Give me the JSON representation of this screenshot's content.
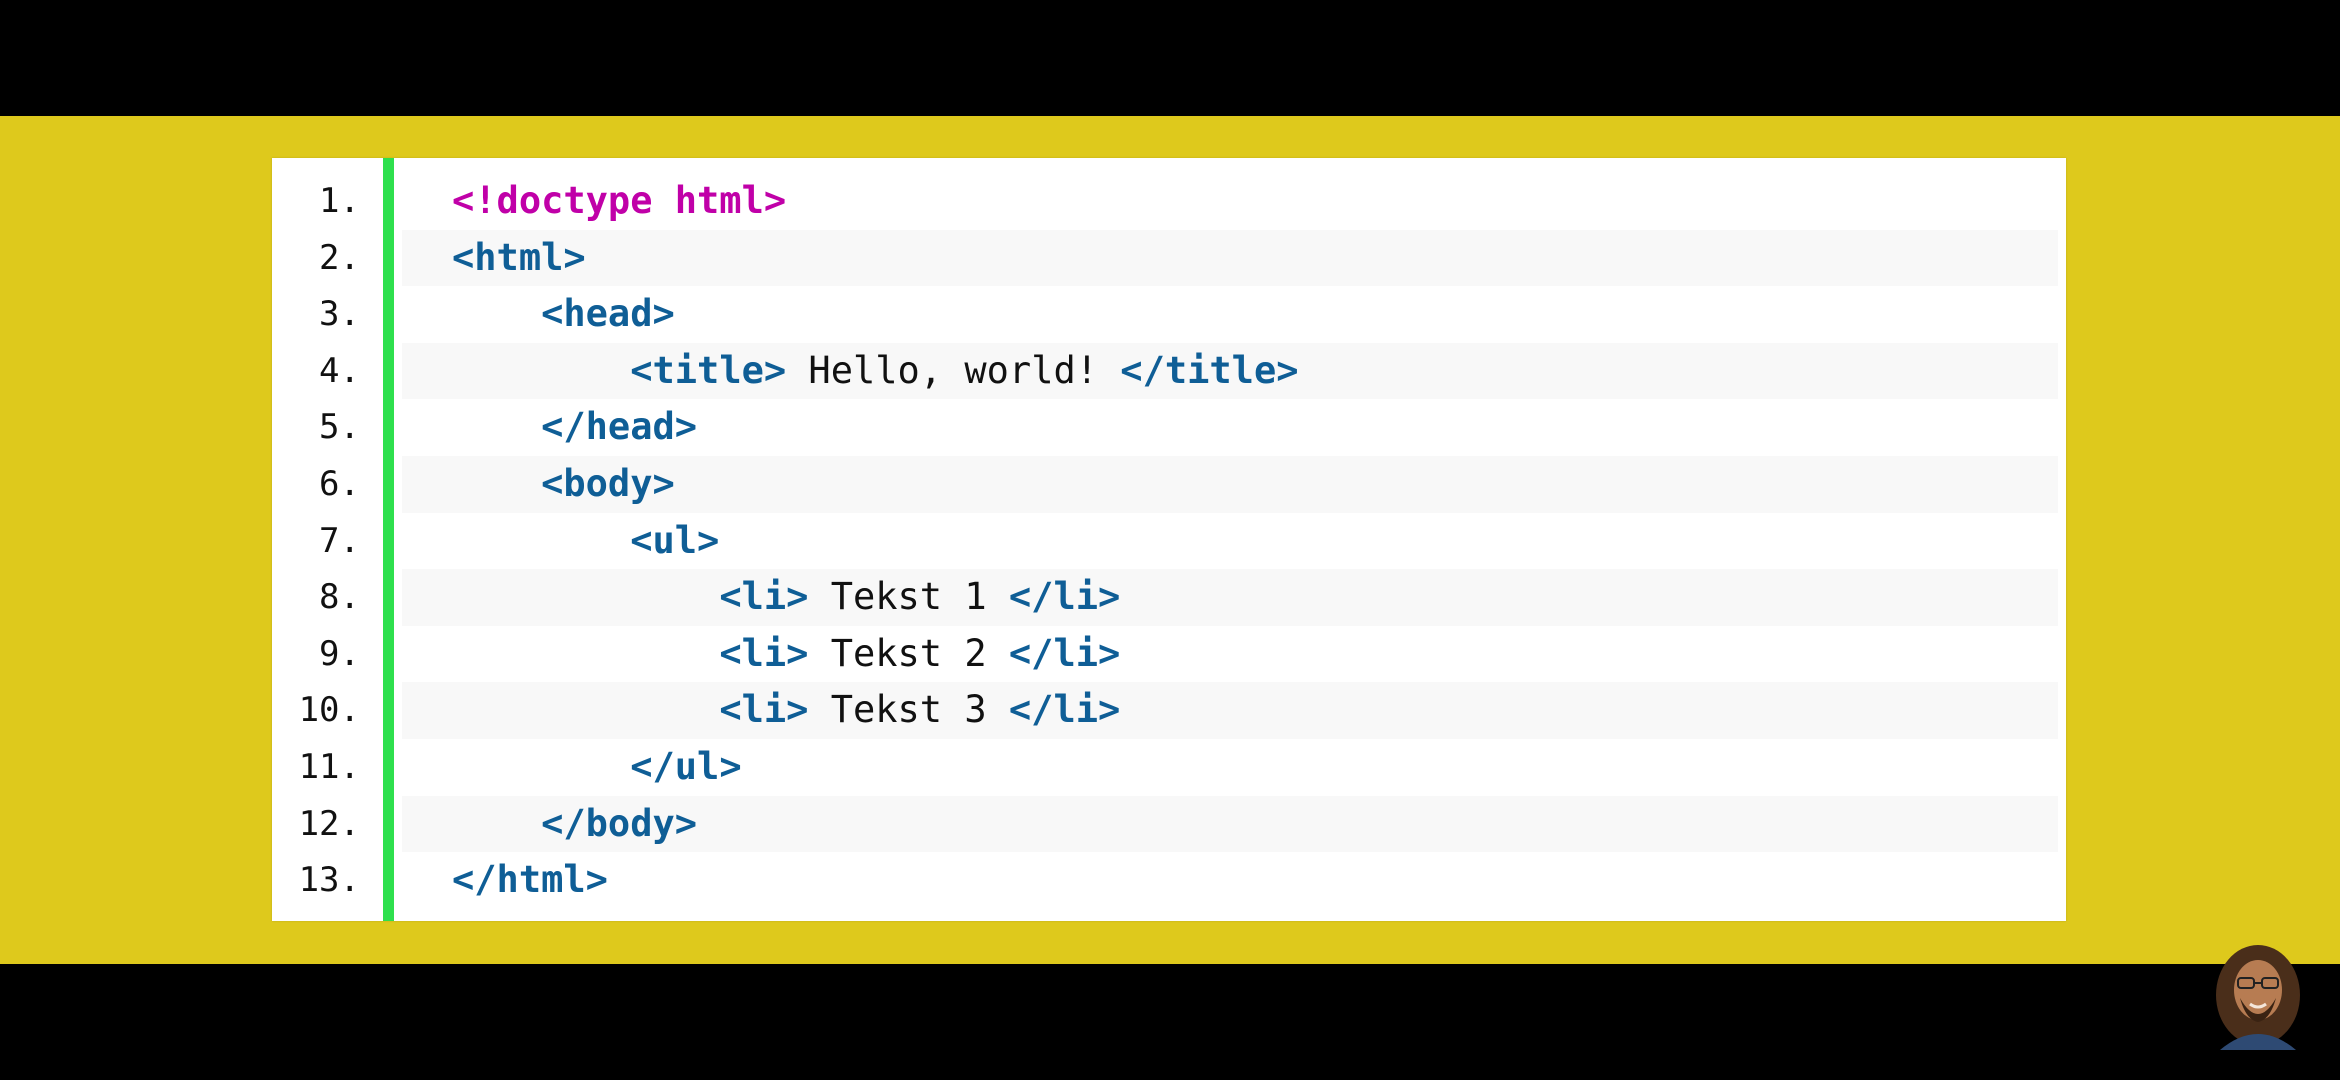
{
  "code": {
    "lines": [
      {
        "number": "1.",
        "indent": "",
        "tokens": [
          {
            "t": "<!doctype html>",
            "k": "doctype"
          }
        ]
      },
      {
        "number": "2.",
        "indent": "",
        "tokens": [
          {
            "t": "<html>",
            "k": "tag"
          }
        ]
      },
      {
        "number": "3.",
        "indent": "    ",
        "tokens": [
          {
            "t": "<head>",
            "k": "tag"
          }
        ]
      },
      {
        "number": "4.",
        "indent": "        ",
        "tokens": [
          {
            "t": "<title>",
            "k": "tag"
          },
          {
            "t": " Hello, world! ",
            "k": "text"
          },
          {
            "t": "</title>",
            "k": "tag"
          }
        ]
      },
      {
        "number": "5.",
        "indent": "    ",
        "tokens": [
          {
            "t": "</head>",
            "k": "tag"
          }
        ]
      },
      {
        "number": "6.",
        "indent": "    ",
        "tokens": [
          {
            "t": "<body>",
            "k": "tag"
          }
        ]
      },
      {
        "number": "7.",
        "indent": "        ",
        "tokens": [
          {
            "t": "<ul>",
            "k": "tag"
          }
        ]
      },
      {
        "number": "8.",
        "indent": "            ",
        "tokens": [
          {
            "t": "<li>",
            "k": "tag"
          },
          {
            "t": " Tekst 1 ",
            "k": "text"
          },
          {
            "t": "</li>",
            "k": "tag"
          }
        ]
      },
      {
        "number": "9.",
        "indent": "            ",
        "tokens": [
          {
            "t": "<li>",
            "k": "tag"
          },
          {
            "t": " Tekst 2 ",
            "k": "text"
          },
          {
            "t": "</li>",
            "k": "tag"
          }
        ]
      },
      {
        "number": "10.",
        "indent": "            ",
        "tokens": [
          {
            "t": "<li>",
            "k": "tag"
          },
          {
            "t": " Tekst 3 ",
            "k": "text"
          },
          {
            "t": "</li>",
            "k": "tag"
          }
        ]
      },
      {
        "number": "11.",
        "indent": "        ",
        "tokens": [
          {
            "t": "</ul>",
            "k": "tag"
          }
        ]
      },
      {
        "number": "12.",
        "indent": "    ",
        "tokens": [
          {
            "t": "</body>",
            "k": "tag"
          }
        ]
      },
      {
        "number": "13.",
        "indent": "",
        "tokens": [
          {
            "t": "</html>",
            "k": "tag"
          }
        ]
      }
    ]
  },
  "colors": {
    "background": "#000000",
    "band": "#DEC91C",
    "card": "#FFFFFF",
    "gutter_bar": "#2EE04D",
    "doctype": "#C000A8",
    "tag": "#0F5E96",
    "text": "#111111"
  },
  "avatar": {
    "icon": "presenter-avatar-icon"
  }
}
